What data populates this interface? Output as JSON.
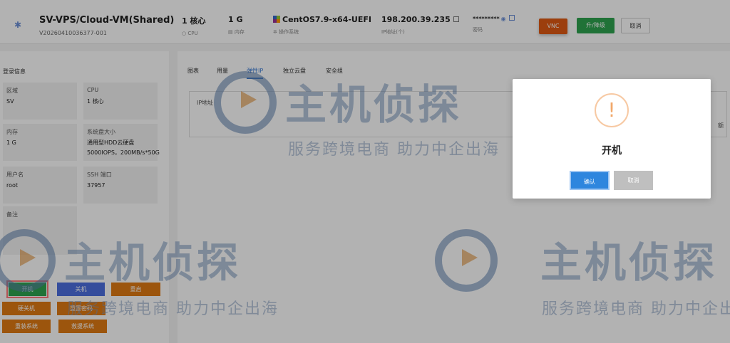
{
  "header": {
    "title": "SV-VPS/Cloud-VM(Shared)",
    "id": "V20260410036377-001",
    "cpu_value": "1 核心",
    "cpu_label": "CPU",
    "mem_value": "1 G",
    "mem_label": "内存",
    "os_value": "CentOS7.9-x64-UEFI",
    "os_label": "操作系统",
    "ip_value": "198.200.39.235",
    "ip_label": "IP地址(个)",
    "password_value": "*********",
    "password_label": "密码",
    "vnc_label": "VNC",
    "upgrade_label": "升/降级",
    "cancel_label": "取消"
  },
  "left_panel": {
    "title": "登录信息",
    "cells": [
      {
        "key": "区域",
        "value": "SV"
      },
      {
        "key": "CPU",
        "value": "1 核心"
      },
      {
        "key": "内存",
        "value": "1 G"
      },
      {
        "key": "系统盘大小",
        "value": "通用型HDD云硬盘",
        "value2": "5000IOPS，200MB/s*50G"
      },
      {
        "key": "用户名",
        "value": "root"
      },
      {
        "key": "SSH 端口",
        "value": "37957"
      },
      {
        "key": "备注",
        "value": ""
      }
    ],
    "actions": {
      "power_on": "开机",
      "power_off": "关机",
      "reboot": "重启",
      "force_off": "硬关机",
      "reset_password": "重置密码",
      "reinstall": "重装系统",
      "rescue": "救援系统"
    }
  },
  "right_panel": {
    "tabs": [
      "图表",
      "用量",
      "弹性IP",
      "独立云盘",
      "安全组"
    ],
    "active_tab": "弹性IP",
    "ip_label": "IP地址",
    "tail_text": "额"
  },
  "watermark": {
    "main": "主机侦探",
    "sub": "服务跨境电商 助力中企出海"
  },
  "modal": {
    "icon": "!",
    "title": "开机",
    "confirm": "确认",
    "cancel": "取消"
  },
  "colors": {
    "accent_blue": "#3a7bd5",
    "green": "#2ea44f",
    "orange": "#e07a14",
    "vnc_orange": "#e05a14"
  }
}
